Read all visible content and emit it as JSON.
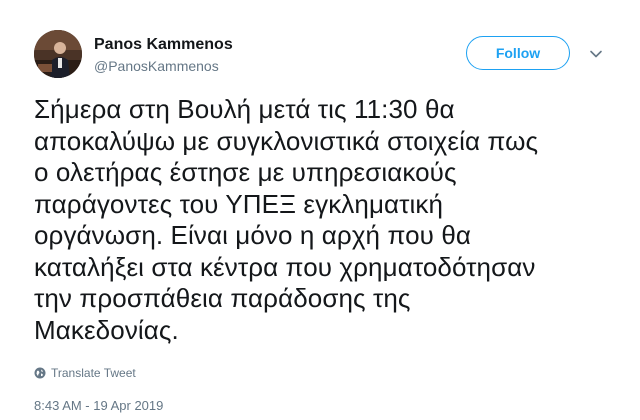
{
  "author": {
    "name": "Panos Kammenos",
    "handle": "@PanosKammenos",
    "avatar_icon": "profile-photo"
  },
  "actions": {
    "follow_label": "Follow",
    "more_icon": "chevron-down-icon"
  },
  "tweet": {
    "text": "Σήμερα στη Βουλή μετά τις 11:30 θα\nαποκαλύψω με συγκλονιστικά στοιχεία πως\nο ολετήρας έστησε με υπηρεσιακούς\nπαράγοντες του ΥΠΕΞ εγκληματική\nοργάνωση. Είναι μόνο η αρχή που θα\nκαταλήξει στα κέντρα που χρηματοδότησαν\nτην προσπάθεια παράδοσης της\nΜακεδονίας.",
    "translate_label": "Translate Tweet",
    "timestamp": "8:43 AM - 19 Apr 2019"
  },
  "colors": {
    "accent": "#1da1f2",
    "text": "#14171a",
    "muted": "#657786"
  }
}
